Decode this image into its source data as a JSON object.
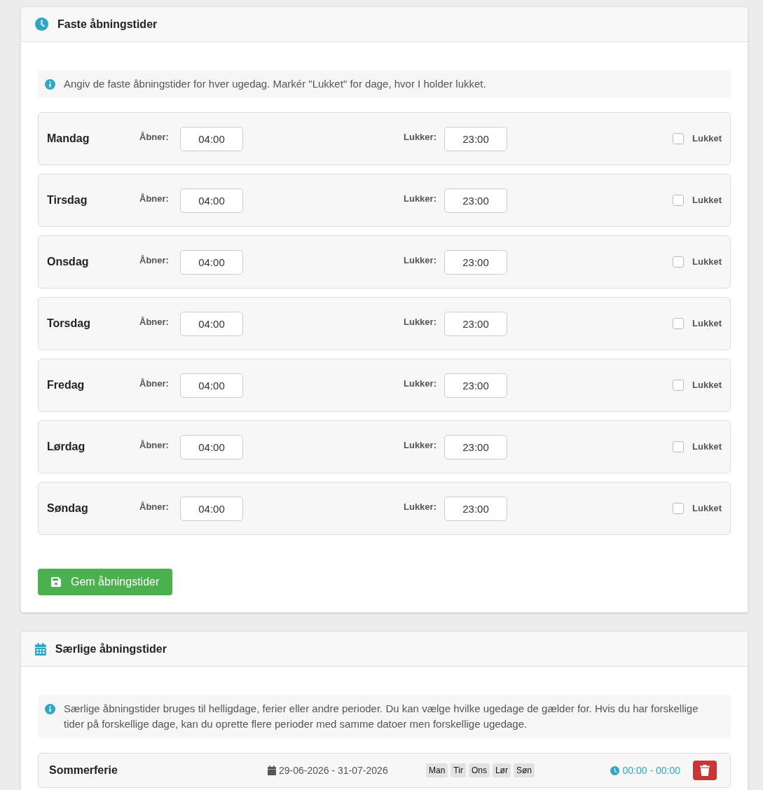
{
  "regular_hours": {
    "title": "Faste åbningstider",
    "info": "Angiv de faste åbningstider for hver ugedag. Markér \"Lukket\" for dage, hvor I holder lukket.",
    "days": [
      {
        "name": "Mandag",
        "open_label": "Åbner:",
        "open": "04:00",
        "close_label": "Lukker:",
        "close": "23:00",
        "closed_label": "Lukket",
        "closed": false
      },
      {
        "name": "Tirsdag",
        "open_label": "Åbner:",
        "open": "04:00",
        "close_label": "Lukker:",
        "close": "23:00",
        "closed_label": "Lukket",
        "closed": false
      },
      {
        "name": "Onsdag",
        "open_label": "Åbner:",
        "open": "04:00",
        "close_label": "Lukker:",
        "close": "23:00",
        "closed_label": "Lukket",
        "closed": false
      },
      {
        "name": "Torsdag",
        "open_label": "Åbner:",
        "open": "04:00",
        "close_label": "Lukker:",
        "close": "23:00",
        "closed_label": "Lukket",
        "closed": false
      },
      {
        "name": "Fredag",
        "open_label": "Åbner:",
        "open": "04:00",
        "close_label": "Lukker:",
        "close": "23:00",
        "closed_label": "Lukket",
        "closed": false
      },
      {
        "name": "Lørdag",
        "open_label": "Åbner:",
        "open": "04:00",
        "close_label": "Lukker:",
        "close": "23:00",
        "closed_label": "Lukket",
        "closed": false
      },
      {
        "name": "Søndag",
        "open_label": "Åbner:",
        "open": "04:00",
        "close_label": "Lukker:",
        "close": "23:00",
        "closed_label": "Lukket",
        "closed": false
      }
    ],
    "save_button": "Gem åbningstider"
  },
  "special_hours": {
    "title": "Særlige åbningstider",
    "info": "Særlige åbningstider bruges til helligdage, ferier eller andre perioder. Du kan vælge hvilke ugedage de gælder for. Hvis du har forskellige tider på forskellige dage, kan du oprette flere perioder med samme datoer men forskellige ugedage.",
    "periods": [
      {
        "name": "Sommerferie",
        "dates": "29-06-2026 - 31-07-2026",
        "weekdays": [
          "Man",
          "Tir",
          "Ons",
          "Lør",
          "Søn"
        ],
        "time": "00:00 - 00:00"
      }
    ]
  }
}
